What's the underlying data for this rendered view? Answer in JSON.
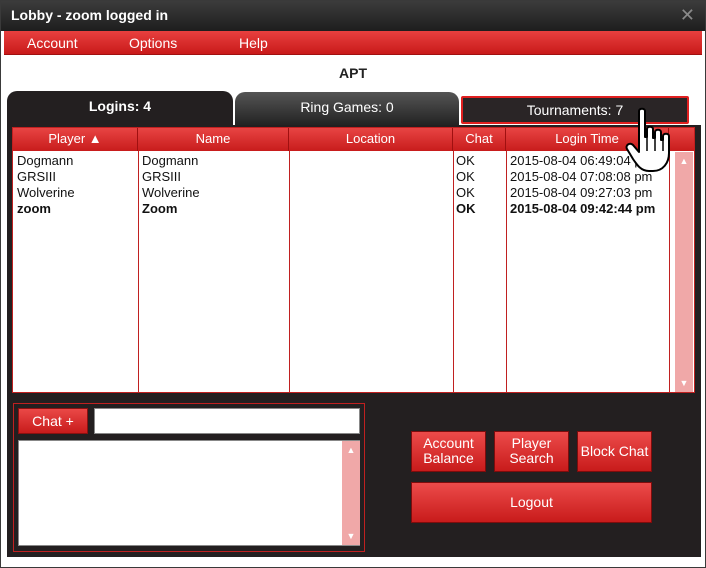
{
  "window": {
    "title": "Lobby - zoom logged in",
    "close_glyph": "✕"
  },
  "menu": [
    {
      "label": "Account"
    },
    {
      "label": "Options"
    },
    {
      "label": "Help"
    }
  ],
  "app_title": "APT",
  "tabs": {
    "logins": "Logins: 4",
    "ring_games": "Ring Games: 0",
    "tournaments": "Tournaments: 7"
  },
  "table": {
    "columns": [
      "Player ▲",
      "Name",
      "Location",
      "Chat",
      "Login Time"
    ],
    "rows": [
      {
        "player": "Dogmann",
        "name": "Dogmann",
        "location": "",
        "chat": "OK",
        "login_time": "2015-08-04 06:49:04 pm"
      },
      {
        "player": "GRSIII",
        "name": "GRSIII",
        "location": "",
        "chat": "OK",
        "login_time": "2015-08-04 07:08:08 pm"
      },
      {
        "player": "Wolverine",
        "name": "Wolverine",
        "location": "",
        "chat": "OK",
        "login_time": "2015-08-04 09:27:03 pm"
      },
      {
        "player": "zoom",
        "name": "Zoom",
        "location": "",
        "chat": "OK",
        "login_time": "2015-08-04 09:42:44 pm"
      }
    ]
  },
  "chat": {
    "button_label": "Chat +",
    "input_value": ""
  },
  "buttons": {
    "account_balance": [
      "Account",
      "Balance"
    ],
    "player_search": [
      "Player",
      "Search"
    ],
    "block_chat": "Block Chat",
    "logout": "Logout"
  },
  "colors": {
    "accent": "#d42626",
    "panel": "#231f20",
    "scroll": "#f0a8a8"
  },
  "icons": {
    "cursor": "hand-pointer-icon",
    "scroll_up": "arrow-up-icon",
    "scroll_down": "arrow-down-icon"
  }
}
